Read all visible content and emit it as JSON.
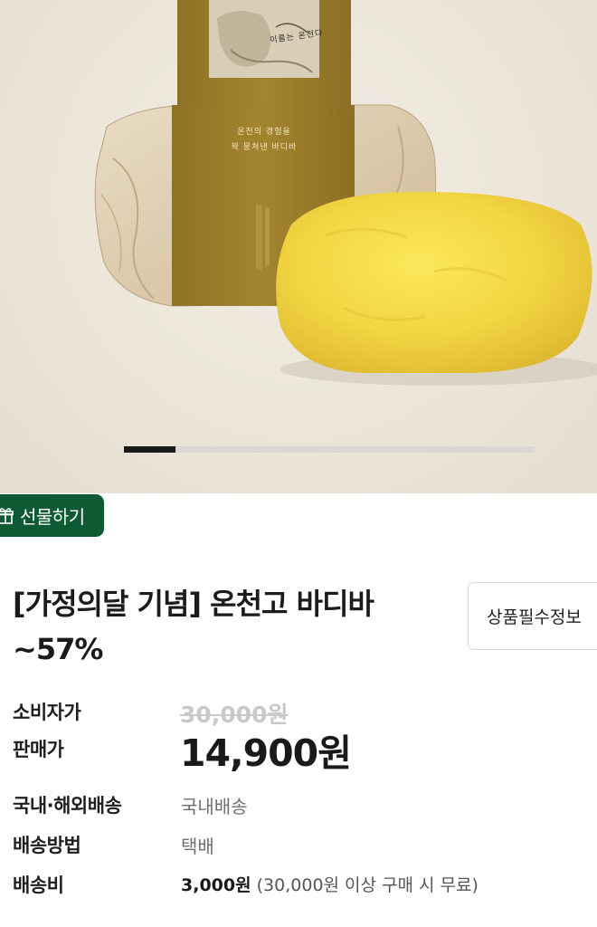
{
  "hero": {
    "box_text_lines": [
      "온천의 경험을",
      "꽉 뭉쳐낸 바디바"
    ],
    "logo_text": "이름는 온천다",
    "slider_progress": 0.125
  },
  "gift_button": {
    "label": "선물하기"
  },
  "product": {
    "title_line1": "[가정의달 기념] 온천고 바디바",
    "title_line2": "~57%"
  },
  "info_button": {
    "label": "상품필수정보"
  },
  "price": {
    "consumer_label": "소비자가",
    "consumer_value": "30,000원",
    "sale_label": "판매가",
    "sale_value": "14,900원"
  },
  "shipping": {
    "region_label": "국내·해외배송",
    "region_value": "국내배송",
    "method_label": "배송방법",
    "method_value": "택배",
    "fee_label": "배송비",
    "fee_amount": "3,000원",
    "fee_note": " (30,000원 이상 구매 시 무료)"
  },
  "colors": {
    "gift_green": "#0e5a32",
    "box_gold": "#9c7d2c",
    "bar_yellow": "#f2d542"
  }
}
